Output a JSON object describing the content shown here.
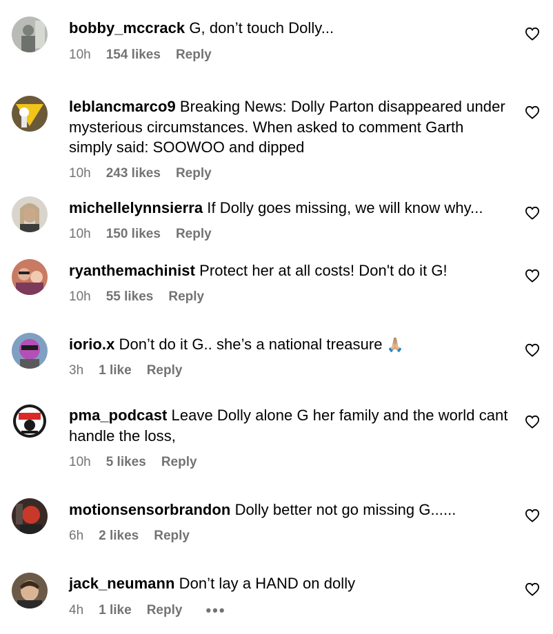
{
  "comments": [
    {
      "user": "bobby_mccrack",
      "text": "G, don’t touch Dolly...",
      "time": "10h",
      "likes": "154 likes",
      "reply": "Reply",
      "avatar_color": "#8a8f8a"
    },
    {
      "user": "leblancmarco9",
      "text": "Breaking News: Dolly Parton disappeared under mysterious circumstances. When asked to comment Garth simply said: SOOWOO and dipped",
      "time": "10h",
      "likes": "243 likes",
      "reply": "Reply",
      "avatar_color": "#f0c419"
    },
    {
      "user": "michellelynnsierra",
      "text": "If Dolly goes missing, we will know why...",
      "time": "10h",
      "likes": "150 likes",
      "reply": "Reply",
      "avatar_color": "#c9b9a8"
    },
    {
      "user": "ryanthemachinist",
      "text": "Protect her at all costs! Don't do it G!",
      "time": "10h",
      "likes": "55 likes",
      "reply": "Reply",
      "avatar_color": "#d98c6f"
    },
    {
      "user": "iorio.x",
      "text": "Don’t do it G.. she’s a national treasure",
      "emoji": "🙏🏼",
      "time": "3h",
      "likes": "1 like",
      "reply": "Reply",
      "avatar_color": "#9b6fb8"
    },
    {
      "user": "pma_podcast",
      "text": "Leave Dolly alone G her family and the world cant handle the loss,",
      "time": "10h",
      "likes": "5 likes",
      "reply": "Reply",
      "avatar_color": "#1a1a1a"
    },
    {
      "user": "motionsensorbrandon",
      "text": "Dolly better not go missing G......",
      "time": "6h",
      "likes": "2 likes",
      "reply": "Reply",
      "avatar_color": "#7a2a22"
    },
    {
      "user": "jack_neumann",
      "text": "Don’t lay a HAND on dolly",
      "time": "4h",
      "likes": "1 like",
      "reply": "Reply",
      "more": "•••",
      "avatar_color": "#5a4636"
    }
  ],
  "colors": {
    "meta": "#737373",
    "text": "#000000",
    "background": "#ffffff"
  },
  "icons": {
    "like": "heart-outline-icon",
    "more": "more-options-icon"
  }
}
